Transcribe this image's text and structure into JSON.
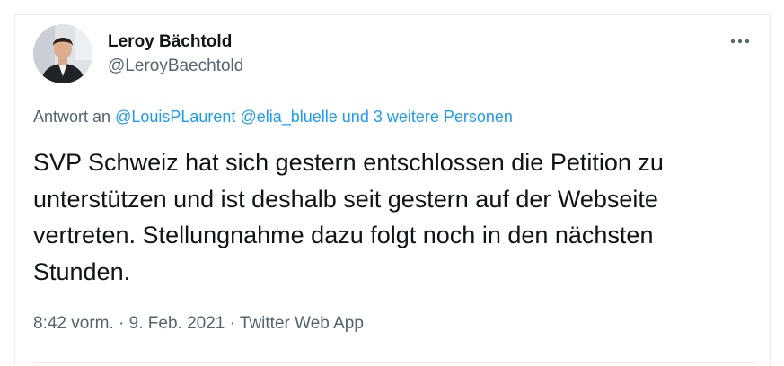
{
  "author": {
    "display_name": "Leroy Bächtold",
    "handle": "@LeroyBaechtold",
    "avatar_icon": "profile-photo"
  },
  "more_icon": "more-horizontal-icon",
  "reply": {
    "prefix": "Antwort an",
    "mention_1": "@LouisPLaurent",
    "mention_2": "@elia_bluelle",
    "others": "und 3 weitere Personen"
  },
  "tweet": {
    "text": "SVP Schweiz hat sich gestern entschlossen die Petition zu unterstützen und ist deshalb seit gestern auf der Webseite vertreten. Stellungnahme dazu folgt noch in den nächsten Stunden."
  },
  "meta": {
    "time": "8:42 vorm.",
    "separator_1": " · ",
    "date": "9. Feb. 2021",
    "separator_2": " · ",
    "source": "Twitter Web App"
  },
  "colors": {
    "link": "#1d9bf0",
    "secondary_text": "#536471",
    "primary_text": "#0f1419",
    "border": "#e6ecf0"
  }
}
